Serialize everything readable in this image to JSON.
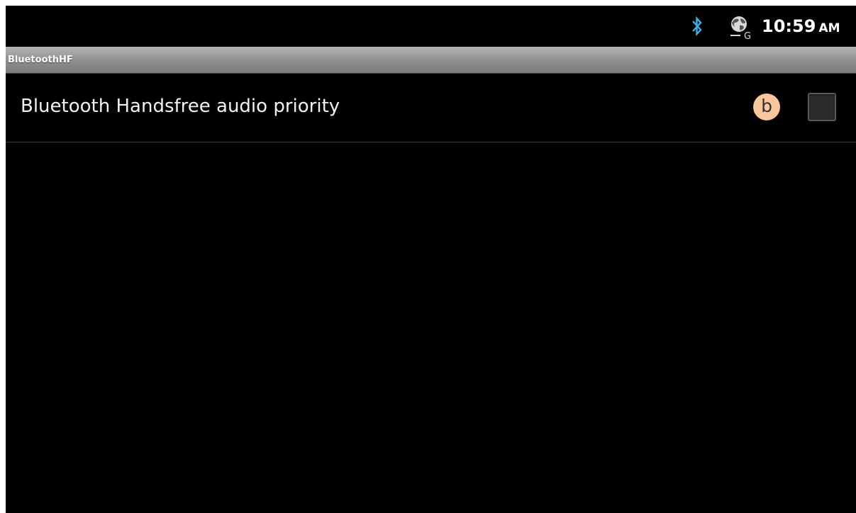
{
  "status_bar": {
    "bluetooth_icon": "bluetooth-icon",
    "network_icon": "globe-network-icon",
    "network_label": "G",
    "time": "10:59",
    "ampm": "AM",
    "bluetooth_color": "#33b5e5"
  },
  "title_bar": {
    "title": "BluetoothHF"
  },
  "preferences": [
    {
      "label": "Bluetooth Handsfree audio priority",
      "badge": "b",
      "checked": false
    }
  ],
  "colors": {
    "background": "#000000",
    "badge": "#f9c79c"
  }
}
